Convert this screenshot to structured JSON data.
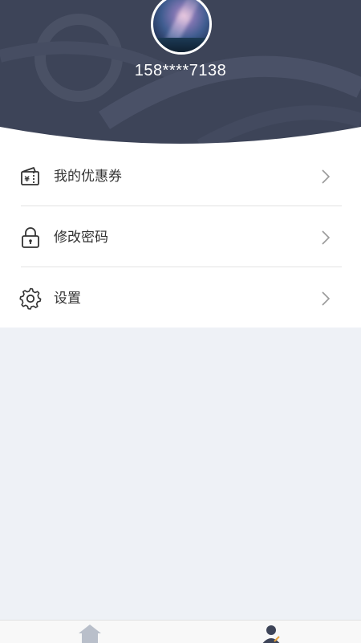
{
  "profile": {
    "phone": "158****7138"
  },
  "menu": {
    "items": [
      {
        "label": "我的优惠券",
        "icon": "coupon-icon"
      },
      {
        "label": "修改密码",
        "icon": "lock-icon"
      },
      {
        "label": "设置",
        "icon": "gear-icon"
      }
    ]
  },
  "tabbar": {
    "tabs": [
      {
        "icon": "home-icon"
      },
      {
        "icon": "user-icon",
        "active": true
      }
    ]
  },
  "colors": {
    "header": "#3d4458",
    "page_background": "#eef1f6",
    "text": "#333333"
  }
}
